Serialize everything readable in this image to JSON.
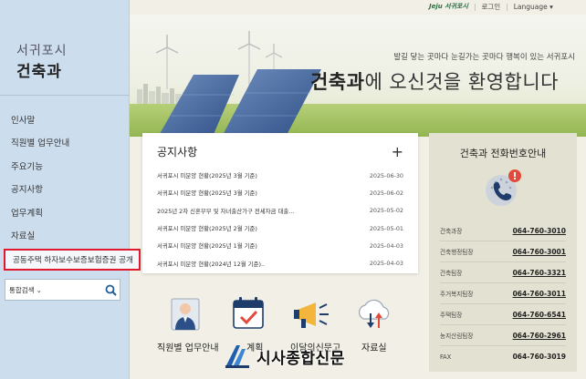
{
  "topbar": {
    "logo": "Jeju 서귀포시",
    "login": "로그인",
    "language": "Language"
  },
  "sidebar": {
    "dept_label": "서귀포시",
    "dept_title": "건축과",
    "items": [
      {
        "label": "인사말"
      },
      {
        "label": "직원별 업무안내"
      },
      {
        "label": "주요기능"
      },
      {
        "label": "공지사항"
      },
      {
        "label": "업무계획"
      },
      {
        "label": "자료실"
      },
      {
        "label": "공동주택 하자보수보증보험증권 공개"
      }
    ],
    "search": {
      "select": "통합검색",
      "value": ""
    }
  },
  "hero": {
    "subtitle": "발길 닿는 곳마다 눈길가는 곳마다 행복이 있는 서귀포시",
    "title_bold": "건축과",
    "title_rest": "에 오신것을 환영합니다"
  },
  "notice": {
    "title": "공지사항",
    "more": "+",
    "rows": [
      {
        "title": "서귀포시 미분양 현황(2025년 3월 기준)",
        "date": "2025-06-30"
      },
      {
        "title": "서귀포시 미분양 현황(2025년 3월 기준)",
        "date": "2025-06-02"
      },
      {
        "title": "2025년 2차 신혼부부 및 자녀출산가구 전세자금 대출...",
        "date": "2025-05-02"
      },
      {
        "title": "서귀포시 미분양 현황(2025년 2월 기준)",
        "date": "2025-05-01"
      },
      {
        "title": "서귀포시 미분양 현황(2025년 1월 기준)",
        "date": "2025-04-03"
      },
      {
        "title": "서귀포시 미분양 현황(2024년 12월 기준)..",
        "date": "2025-04-03"
      }
    ]
  },
  "phone": {
    "title": "건축과 전화번호안내",
    "rows": [
      {
        "label": "건축과장",
        "number": "064-760-3010"
      },
      {
        "label": "건축행정팀장",
        "number": "064-760-3001"
      },
      {
        "label": "건축팀장",
        "number": "064-760-3321"
      },
      {
        "label": "주거복지팀장",
        "number": "064-760-3011"
      },
      {
        "label": "주택팀장",
        "number": "064-760-6541"
      },
      {
        "label": "농지산림팀장",
        "number": "064-760-2961"
      },
      {
        "label": "FAX",
        "number": "064-760-3019"
      }
    ]
  },
  "quick": {
    "items": [
      {
        "label": "직원별 업무안내"
      },
      {
        "label": "계획"
      },
      {
        "label": "이달의신문고"
      },
      {
        "label": "자료실"
      }
    ]
  },
  "watermark": {
    "text": "시사종합신문"
  },
  "colors": {
    "highlight": "#e0192d",
    "sidebar": "#ccdded",
    "phone_bg": "#e3e1d1",
    "page_bg": "#f2f0e6"
  }
}
